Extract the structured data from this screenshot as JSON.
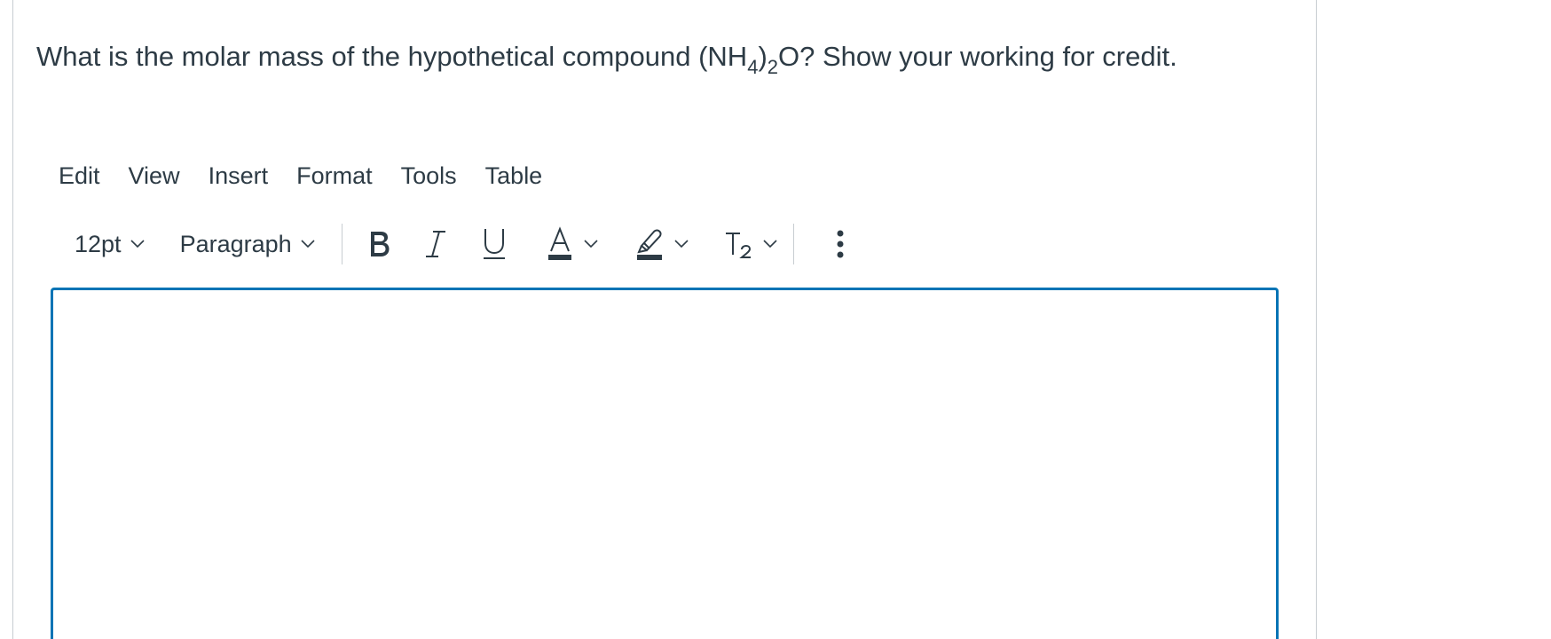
{
  "question": {
    "text_before": "What is the molar mass of the hypothetical compound (NH",
    "sub1": "4",
    "text_mid": ")",
    "sub2": "2",
    "text_after": "O? Show your working for credit."
  },
  "menubar": {
    "items": [
      "Edit",
      "View",
      "Insert",
      "Format",
      "Tools",
      "Table"
    ]
  },
  "toolbar": {
    "font_size": "12pt",
    "block_format": "Paragraph",
    "bold_icon": "bold-icon",
    "italic_icon": "italic-icon",
    "underline_icon": "underline-icon",
    "text_color_icon": "text-color-icon",
    "highlight_icon": "highlight-color-icon",
    "subscript_icon": "subscript-icon",
    "more_icon": "more-vertical-icon"
  },
  "colors": {
    "text": "#2d3b45",
    "accent": "#0374b5",
    "border": "#c7cdd1"
  }
}
